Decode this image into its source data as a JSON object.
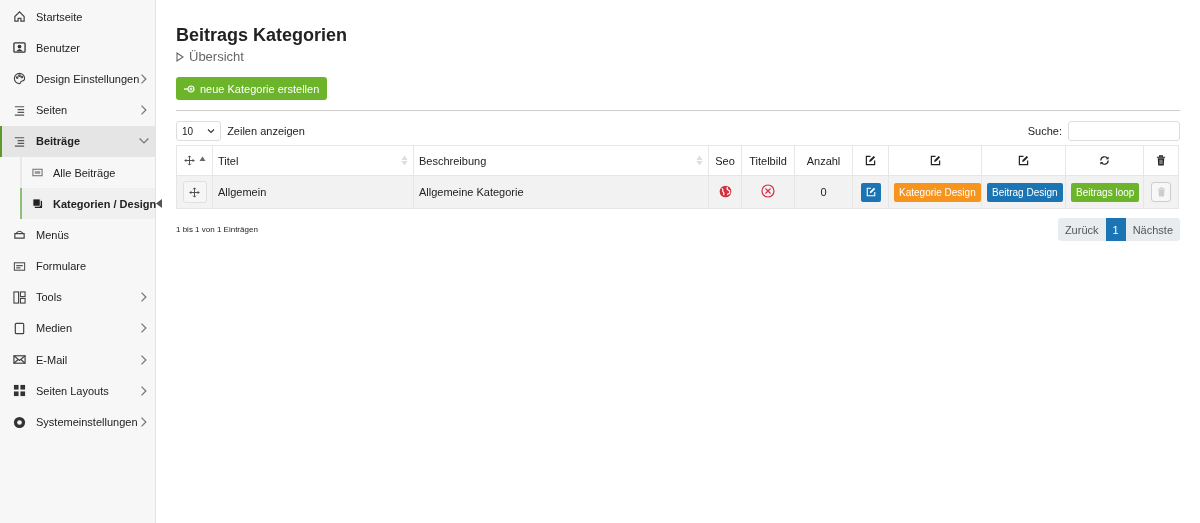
{
  "sidebar": {
    "items": [
      {
        "label": "Startseite",
        "selected": false
      },
      {
        "label": "Benutzer",
        "selected": false
      },
      {
        "label": "Design Einstellungen",
        "expandable": true,
        "expanded": false,
        "selected": false
      },
      {
        "label": "Seiten",
        "expandable": true,
        "expanded": false,
        "selected": false
      },
      {
        "label": "Beiträge",
        "expandable": true,
        "expanded": true,
        "selected": true,
        "children": [
          {
            "label": "Alle Beiträge",
            "selected": false
          },
          {
            "label": "Kategorien / Design",
            "selected": true
          }
        ]
      },
      {
        "label": "Menüs",
        "selected": false
      },
      {
        "label": "Formulare",
        "selected": false
      },
      {
        "label": "Tools",
        "expandable": true,
        "expanded": false,
        "selected": false
      },
      {
        "label": "Medien",
        "expandable": true,
        "expanded": false,
        "selected": false
      },
      {
        "label": "E-Mail",
        "expandable": true,
        "expanded": false,
        "selected": false
      },
      {
        "label": "Seiten Layouts",
        "expandable": true,
        "expanded": false,
        "selected": false
      },
      {
        "label": "Systemeinstellungen",
        "expandable": true,
        "expanded": false,
        "selected": false
      }
    ]
  },
  "page": {
    "title": "Beitrags Kategorien",
    "breadcrumb": "Übersicht",
    "create_button": "neue Kategorie erstellen"
  },
  "table_controls": {
    "page_size": "10",
    "page_size_label": "Zeilen anzeigen",
    "search_label": "Suche:"
  },
  "table": {
    "columns": [
      {
        "kind": "drag",
        "sortable": true,
        "sorted": true
      },
      {
        "kind": "text",
        "label": "Titel",
        "sortable": true,
        "sorted": false
      },
      {
        "kind": "text",
        "label": "Beschreibung",
        "sortable": true,
        "sorted": false
      },
      {
        "kind": "text",
        "label": "Seo"
      },
      {
        "kind": "text",
        "label": "Titelbild"
      },
      {
        "kind": "text",
        "label": "Anzahl"
      },
      {
        "kind": "edit"
      },
      {
        "kind": "edit"
      },
      {
        "kind": "edit"
      },
      {
        "kind": "refresh"
      },
      {
        "kind": "trash"
      }
    ],
    "rows": [
      {
        "title": "Allgemein",
        "description": "Allgemeine Kategorie",
        "seo_set": false,
        "has_title_image": false,
        "count": "0",
        "actions": [
          {
            "kind": "edit",
            "color": "#1b75b4"
          },
          {
            "kind": "label",
            "label": "Kategorie Design",
            "color": "#f7941d"
          },
          {
            "kind": "label",
            "label": "Beitrag Design",
            "color": "#1b75b4"
          },
          {
            "kind": "label",
            "label": "Beitrags loop",
            "color": "#6cb52b"
          },
          {
            "kind": "delete",
            "disabled": true
          }
        ]
      }
    ]
  },
  "footer": {
    "info": "1 bis 1 von 1 Einträgen",
    "previous": "Zurück",
    "pages": [
      {
        "label": "1",
        "selected": true
      }
    ],
    "next": "Nächste"
  }
}
